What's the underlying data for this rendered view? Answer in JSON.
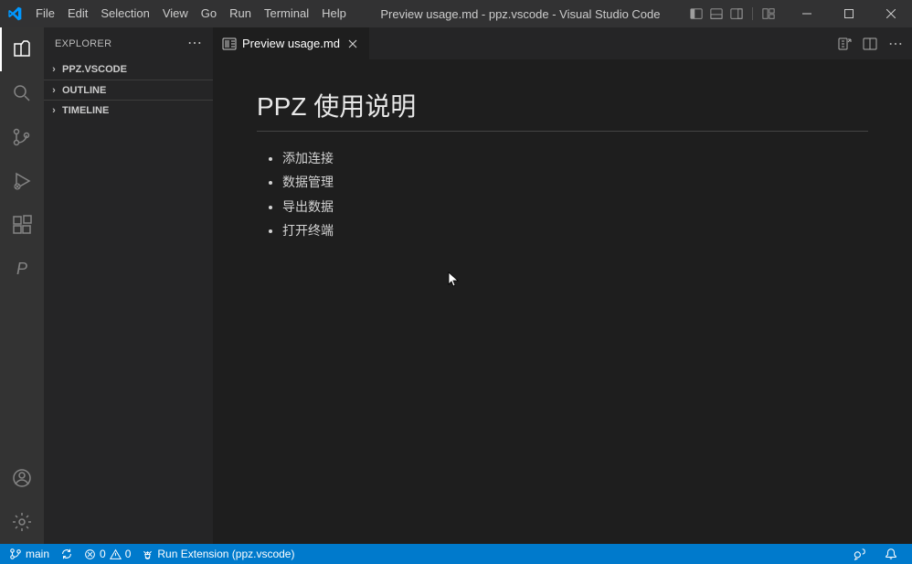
{
  "menu": [
    "File",
    "Edit",
    "Selection",
    "View",
    "Go",
    "Run",
    "Terminal",
    "Help"
  ],
  "window_title": "Preview usage.md - ppz.vscode - Visual Studio Code",
  "sidebar": {
    "title": "EXPLORER",
    "sections": [
      "PPZ.VSCODE",
      "OUTLINE",
      "TIMELINE"
    ]
  },
  "tab": {
    "label": "Preview usage.md"
  },
  "preview": {
    "heading": "PPZ 使用说明",
    "items": [
      "添加连接",
      "数据管理",
      "导出数据",
      "打开终端"
    ]
  },
  "status": {
    "branch": "main",
    "errors": "0",
    "warnings": "0",
    "run": "Run Extension (ppz.vscode)"
  }
}
